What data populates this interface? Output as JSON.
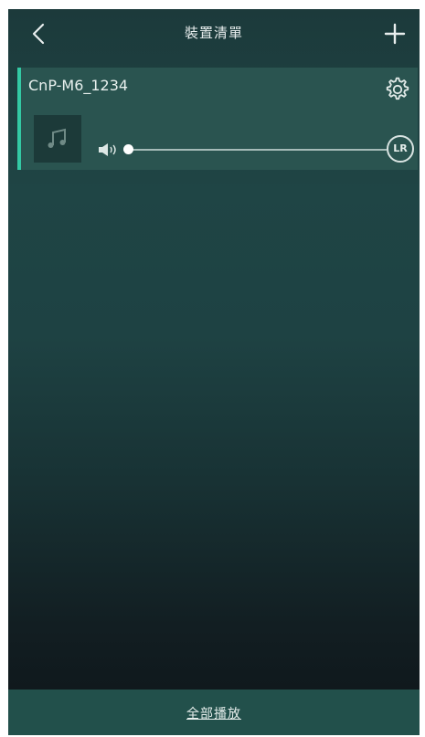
{
  "header": {
    "title": "裝置清單",
    "back_icon": "chevron-left-icon",
    "add_icon": "plus-icon"
  },
  "device": {
    "name": "CnP-M6_1234",
    "settings_icon": "gear-icon",
    "artwork_icon": "music-note-icon",
    "volume_icon": "speaker-icon",
    "volume_level": 0,
    "channel_label": "LR"
  },
  "footer": {
    "play_all_label": "全部播放"
  },
  "colors": {
    "accent": "#33c9a4",
    "card_bg": "#2a5450",
    "footer_bg": "#22504b"
  }
}
